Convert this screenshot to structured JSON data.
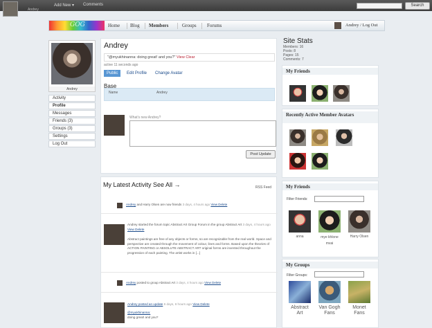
{
  "adminbar": {
    "user": "Andrey",
    "add_new": "Add New",
    "comments": "Comments",
    "search_button": "Search"
  },
  "nav": {
    "logo": "GOG",
    "items": [
      "Home",
      "Blog",
      "Members",
      "Groups",
      "Forums"
    ],
    "active": "Members",
    "user_link": "Andrey / Log Out"
  },
  "profile": {
    "name": "Andrey",
    "status": "\"@myukhinanna: doing great! and you?\"",
    "status_link": "View Clear",
    "active_ago": "active 11 seconds ago",
    "tabs": [
      "Public",
      "Edit Profile",
      "Change Avatar"
    ],
    "base_title": "Base",
    "base_name_label": "Name",
    "base_name_value": "Andrey",
    "whats_new_label": "What's new Andrey?",
    "post_button": "Post Update",
    "menu": [
      "Activity",
      "Profile",
      "Messages",
      "Friends (3)",
      "Groups (3)",
      "Settings",
      "Log Out"
    ]
  },
  "activity": {
    "title": "My Latest Activity See All →",
    "rss": "RSS Feed",
    "line1_user": "Andrey",
    "line1_text": "and Harry Olsen are now friends",
    "line1_time": "3 days, 4 hours ago",
    "line1_actions": "View  Delete",
    "item2_header": "Andrey started the forum topic Abstract Art Group Forum in the group Abstract Art",
    "item2_time": "3 days, 4 hours ago",
    "item2_actions": "View  Delete",
    "item2_body": "Abstract paintings are free of any objects or forms, so are recognizable from the real world. Space and perspective are created through the movement of colour, lines and forms. Based upon the theories of ACTION PAINTING or ABSOLUTE ABSTRACT ART original forms are invented throughout the progression of each painting. The artist works in [...]",
    "line3_user": "Andrey",
    "line3_text": "posted to group Abstract Art",
    "line3_time": "3 days, 4 hours ago",
    "line3_actions": "View  Delete",
    "item4_header": "Andrey posted an update",
    "item4_time": "6 days, 6 hours ago",
    "item4_actions": "View  Delete",
    "item4_mention": "@myukhinanna:",
    "item4_body": "doing great! and you?"
  },
  "site_stats": {
    "title": "Site Stats",
    "members": "Members: 16",
    "posts": "Posts: 8",
    "pages": "Pages: 15",
    "comments": "Comments: 7"
  },
  "widgets": {
    "my_friends_title": "My Friends",
    "recent_title": "Recently Active Member Avatars",
    "my_friends2_title": "My Friends",
    "filter_friends": "Filter Friends:",
    "friends": [
      "anna",
      "mye khlone mvai",
      "Harry Olsen"
    ],
    "my_groups_title": "My Groups",
    "filter_groups": "Filter Groups:",
    "groups": [
      "Abstract Art",
      "Van Gogh Fans",
      "Monet Fans"
    ]
  }
}
